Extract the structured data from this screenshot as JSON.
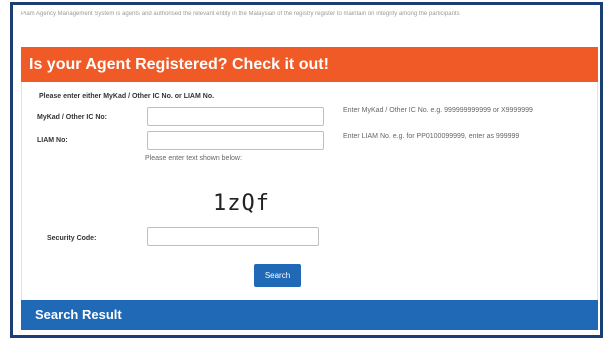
{
  "intro_text": "Piam Agency Management System is agents and authorised the relevant entity in the Malaysian of the registry register to maintain on integrity among the participants",
  "banner_title": "Is your Agent Registered? Check it out!",
  "instruction": "Please enter either MyKad / Other IC No. or LIAM No.",
  "fields": {
    "mykad": {
      "label": "MyKad / Other IC No:",
      "value": "",
      "hint": "Enter MyKad / Other IC No. e.g. 999999999999 or X9999999"
    },
    "liam": {
      "label": "LIAM No:",
      "value": "",
      "hint": "Enter LIAM No. e.g. for PP0100099999, enter as 999999"
    },
    "captcha_prompt": "Please enter text shown below:",
    "captcha_text": "1zQf",
    "security": {
      "label": "Security Code:",
      "value": ""
    }
  },
  "search_label": "Search",
  "result_title": "Search Result",
  "colors": {
    "banner": "#f05a26",
    "primary": "#1f69b6",
    "frame": "#1b3f73"
  }
}
